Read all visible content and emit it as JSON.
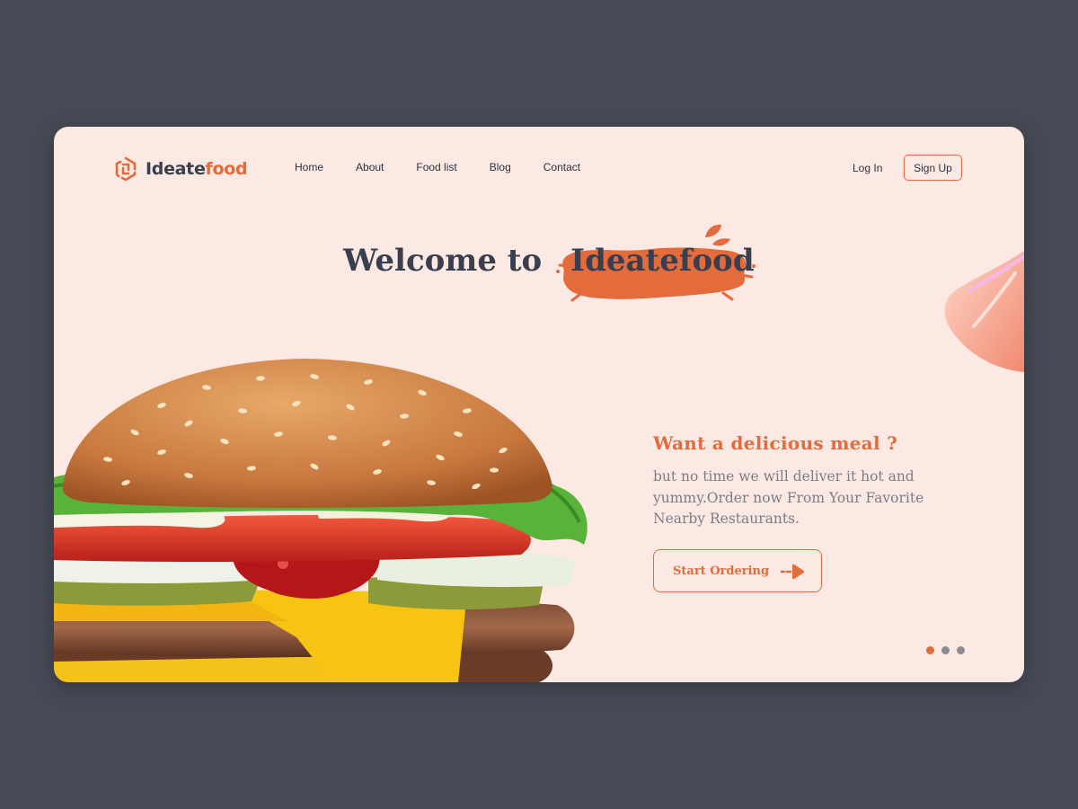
{
  "brand": {
    "name_part1": "Ideate",
    "name_part2": "food"
  },
  "nav": {
    "items": [
      "Home",
      "About",
      "Food list",
      "Blog",
      "Contact"
    ]
  },
  "auth": {
    "login": "Log In",
    "signup": "Sign Up"
  },
  "hero": {
    "title_prefix": "Welcome to",
    "title_brand": "Ideatefood",
    "heading": "Want a delicious meal ?",
    "description": "but no time we will deliver it hot and yummy.Order now From Your Favorite Nearby Restaurants.",
    "cta": "Start Ordering"
  },
  "carousel": {
    "slides": 3,
    "active_index": 0
  },
  "colors": {
    "accent": "#e46b3c",
    "background": "#fde9e3",
    "page": "#464a55",
    "text_dark": "#3a3f4f",
    "text_muted": "#7d7d87"
  },
  "icons": [
    "logo-icon",
    "leaf-icon",
    "arrow-right-icon",
    "burger-image"
  ]
}
